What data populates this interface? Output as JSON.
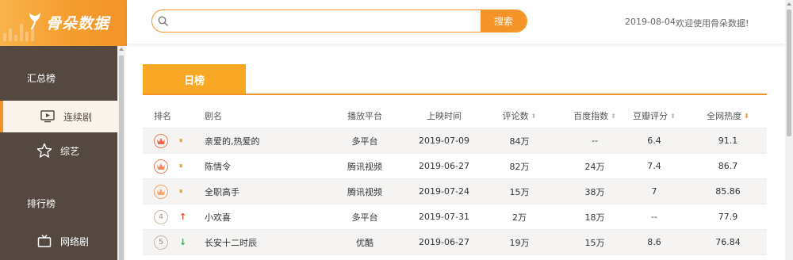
{
  "logo": {
    "text": "骨朵数据"
  },
  "header": {
    "search_placeholder": "",
    "search_button": "搜索",
    "date": "2019-08-04",
    "welcome": "欢迎使用骨朵数据!"
  },
  "sidebar": {
    "group1": "汇总榜",
    "item_series": "连续剧",
    "item_variety": "综艺",
    "group2": "排行榜",
    "item_web": "网络剧"
  },
  "tab": {
    "label": "日榜"
  },
  "colors": {
    "accent": "#f49428",
    "sidebar": "#544840",
    "tab": "#f9a825"
  },
  "table": {
    "headers": {
      "rank": "排名",
      "name": "剧名",
      "platform": "播放平台",
      "date": "上映时间",
      "comments": "评论数",
      "index": "百度指数",
      "score": "豆瓣评分",
      "heat": "全网热度"
    },
    "sorted_column": "heat",
    "rows": [
      {
        "rank": "1",
        "rank_icon": "crown-icon",
        "trend": "flat",
        "name": "亲爱的,热爱的",
        "platform": "多平台",
        "date": "2019-07-09",
        "comments": "84万",
        "index": "--",
        "score": "6.4",
        "heat": "91.1"
      },
      {
        "rank": "2",
        "rank_icon": "crown-icon",
        "trend": "flat",
        "name": "陈情令",
        "platform": "腾讯视频",
        "date": "2019-06-27",
        "comments": "82万",
        "index": "24万",
        "score": "7.4",
        "heat": "86.7"
      },
      {
        "rank": "3",
        "rank_icon": "crown-icon",
        "trend": "flat",
        "name": "全职高手",
        "platform": "腾讯视频",
        "date": "2019-07-24",
        "comments": "15万",
        "index": "38万",
        "score": "7",
        "heat": "85.86"
      },
      {
        "rank": "4",
        "trend": "up",
        "name": "小欢喜",
        "platform": "多平台",
        "date": "2019-07-31",
        "comments": "2万",
        "index": "18万",
        "score": "--",
        "heat": "77.9"
      },
      {
        "rank": "5",
        "trend": "down",
        "name": "长安十二时辰",
        "platform": "优酷",
        "date": "2019-06-27",
        "comments": "19万",
        "index": "15万",
        "score": "8.6",
        "heat": "76.84"
      }
    ]
  }
}
